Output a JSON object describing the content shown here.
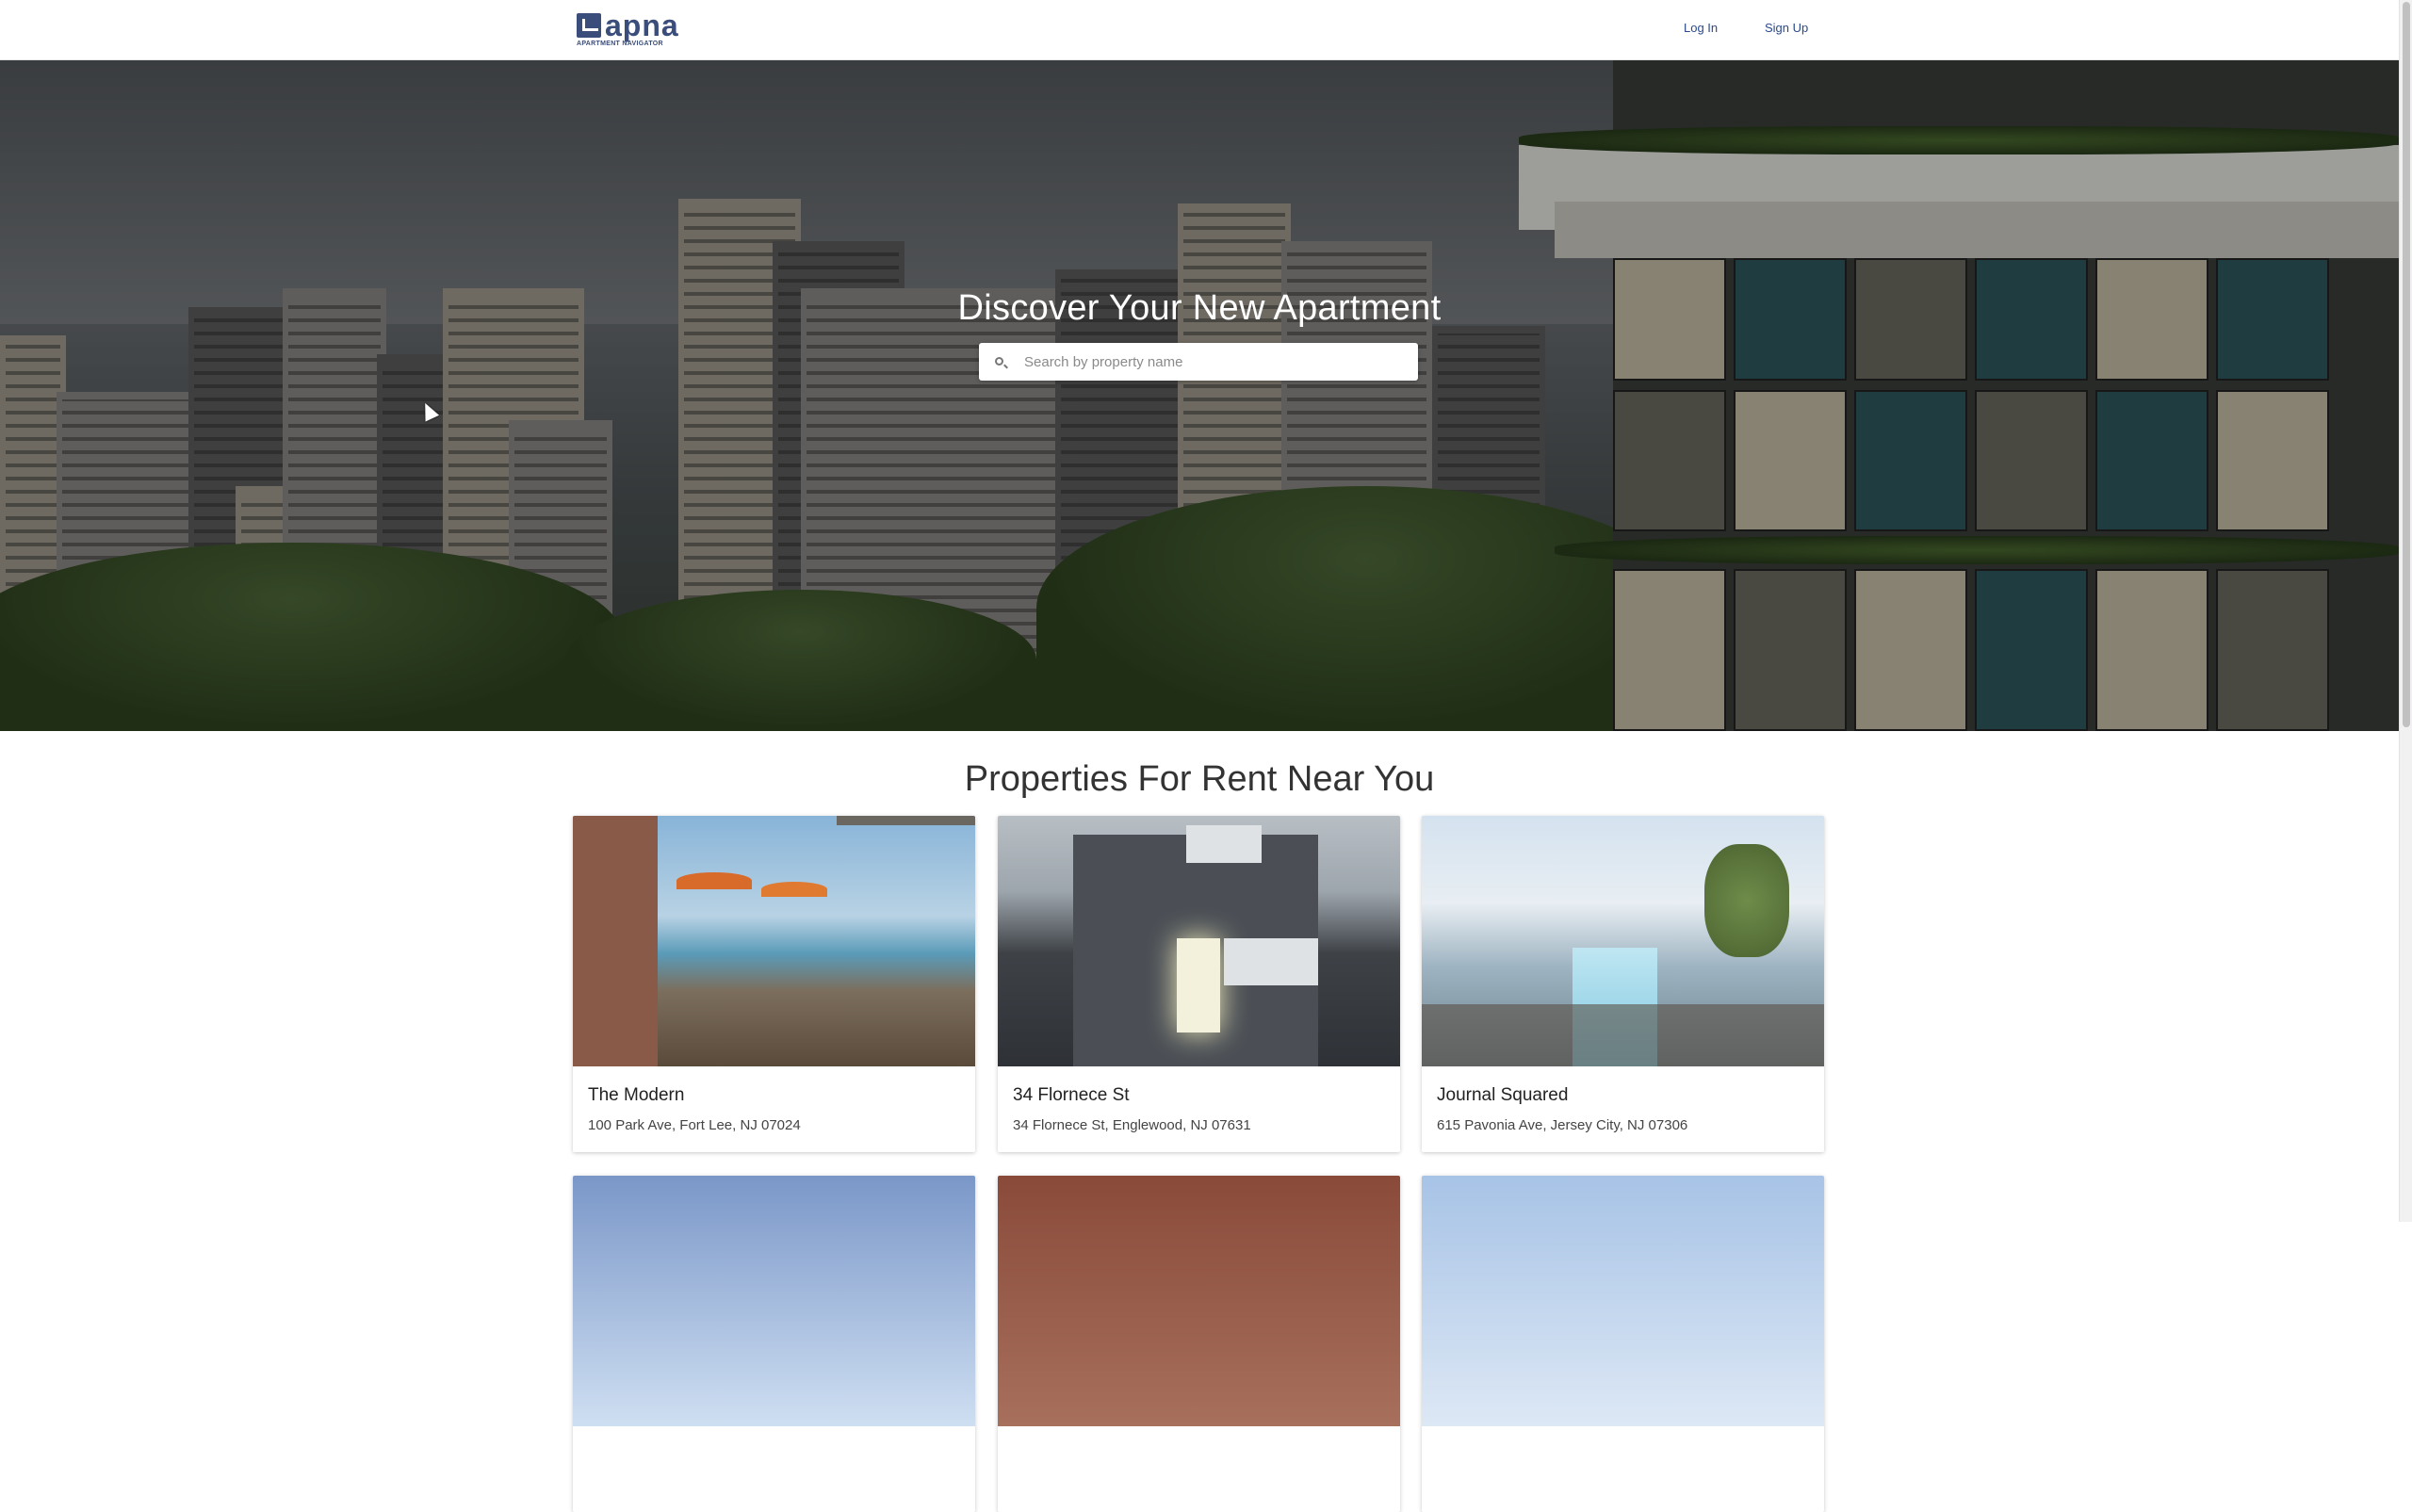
{
  "header": {
    "logo_text": "apna",
    "logo_subtitle": "APARTMENT NAVIGATOR",
    "login_label": "Log In",
    "signup_label": "Sign Up"
  },
  "hero": {
    "title": "Discover Your New Apartment",
    "search_placeholder": "Search by property name",
    "search_value": ""
  },
  "listings": {
    "title": "Properties For Rent Near You",
    "properties": [
      {
        "name": "The Modern",
        "address": "100 Park Ave, Fort Lee, NJ 07024"
      },
      {
        "name": "34 Flornece St",
        "address": "34 Flornece St, Englewood, NJ 07631"
      },
      {
        "name": "Journal Squared",
        "address": "615 Pavonia Ave, Jersey City, NJ 07306"
      }
    ]
  },
  "colors": {
    "brand": "#3b4d7a",
    "nav_link": "#2c4a8a",
    "hero_text": "#ffffff"
  },
  "icons": {
    "search": "search-icon",
    "logo": "logo-icon"
  }
}
